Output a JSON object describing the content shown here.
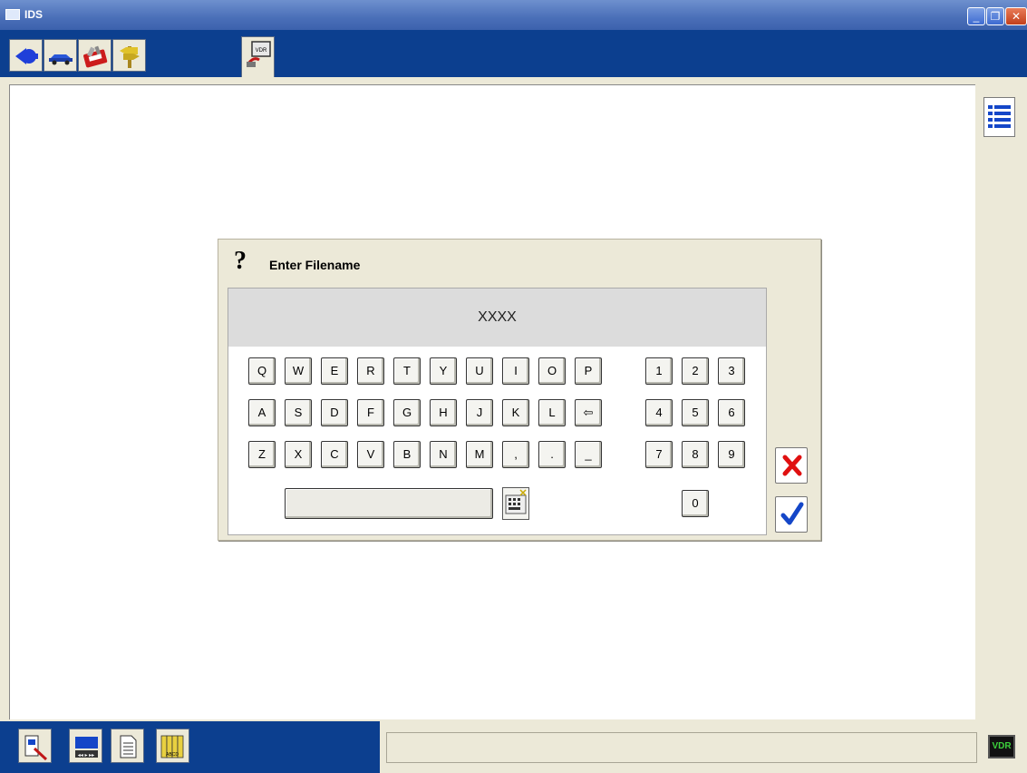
{
  "window": {
    "title": "IDS"
  },
  "toolbar": {
    "buttons": [
      {
        "icon": "back-arrow-icon"
      },
      {
        "icon": "vehicle-icon"
      },
      {
        "icon": "toolbox-icon"
      },
      {
        "icon": "signpost-icon"
      },
      {
        "icon": "vdr-icon",
        "label": "VDR"
      }
    ]
  },
  "dialog": {
    "title": "Enter Filename",
    "prompt_icon": "?",
    "filename_value": "XXXX",
    "keys": {
      "row1": [
        "Q",
        "W",
        "E",
        "R",
        "T",
        "Y",
        "U",
        "I",
        "O",
        "P"
      ],
      "row2": [
        "A",
        "S",
        "D",
        "F",
        "G",
        "H",
        "J",
        "K",
        "L",
        "⇦"
      ],
      "row3": [
        "Z",
        "X",
        "C",
        "V",
        "B",
        "N",
        "M",
        ",",
        ".",
        "_"
      ],
      "numpad": [
        "1",
        "2",
        "3",
        "4",
        "5",
        "6",
        "7",
        "8",
        "9",
        "0"
      ]
    },
    "cancel_icon": "cross-icon",
    "ok_icon": "checkmark-icon",
    "colors": {
      "cancel": "#e01010",
      "ok": "#1446c8"
    }
  },
  "bottombar": {
    "buttons": [
      {
        "icon": "inspect-icon"
      },
      {
        "icon": "recorder-icon"
      },
      {
        "icon": "document-icon"
      },
      {
        "icon": "notebooks-icon",
        "label": "ABCD"
      }
    ],
    "status_text": "",
    "indicator_label": "VDR"
  },
  "colors": {
    "toolbar_bg": "#0c3f8f",
    "panel_bg": "#ece9d8"
  }
}
